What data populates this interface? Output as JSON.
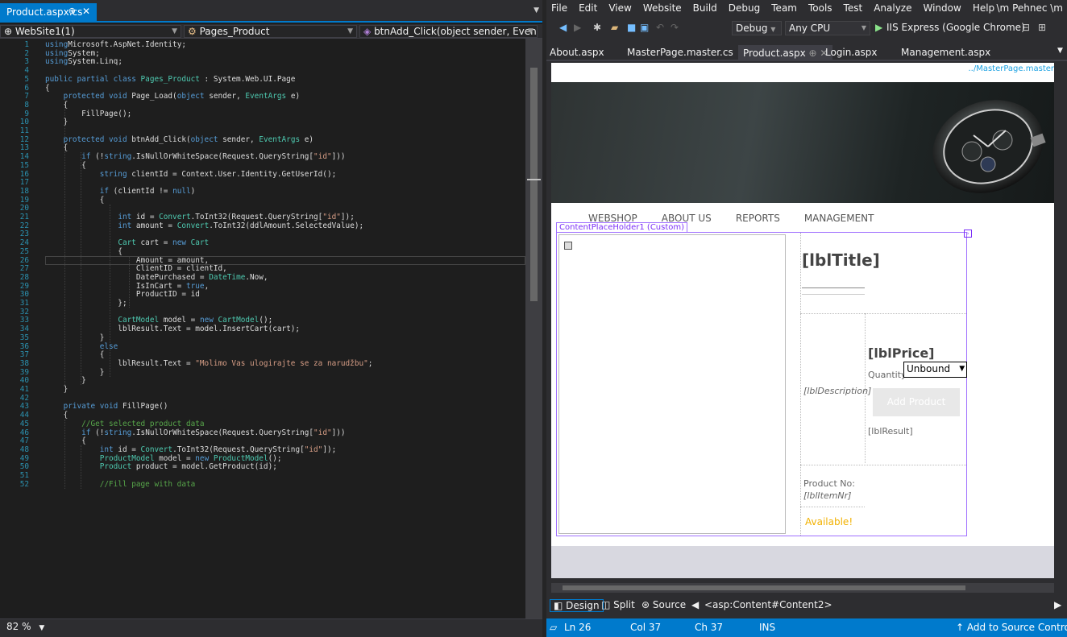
{
  "left_tab": {
    "label": "Product.aspx.cs",
    "pin": "⊕",
    "close": "✕"
  },
  "nav": {
    "project": "WebSite1(1)",
    "class": "Pages_Product",
    "member": "btnAdd_Click(object sender, EventArgs e"
  },
  "zoom": "82 %",
  "code_lines": [
    [
      [
        "kw",
        "using"
      ],
      [
        "",
        "Microsoft.AspNet.Identity;"
      ]
    ],
    [
      [
        "kw",
        "using"
      ],
      [
        "",
        "System;"
      ]
    ],
    [
      [
        "kw",
        "using"
      ],
      [
        "",
        "System.Linq;"
      ]
    ],
    [],
    [
      [
        "kw",
        "public partial class "
      ],
      [
        "ty",
        "Pages_Product"
      ],
      [
        "",
        " : System.Web.UI.Page"
      ]
    ],
    [
      [
        "",
        "{"
      ]
    ],
    [
      [
        "kw",
        "    protected void "
      ],
      [
        "",
        "Page_Load("
      ],
      [
        "kw",
        "object"
      ],
      [
        "",
        " sender, "
      ],
      [
        "ty",
        "EventArgs"
      ],
      [
        "",
        " e)"
      ]
    ],
    [
      [
        "",
        "    {"
      ]
    ],
    [
      [
        "",
        "        FillPage();"
      ]
    ],
    [
      [
        "",
        "    }"
      ]
    ],
    [],
    [
      [
        "kw",
        "    protected void "
      ],
      [
        "",
        "btnAdd_Click("
      ],
      [
        "kw",
        "object"
      ],
      [
        "",
        " sender, "
      ],
      [
        "ty",
        "EventArgs"
      ],
      [
        "",
        " e)"
      ]
    ],
    [
      [
        "",
        "    {"
      ]
    ],
    [
      [
        "",
        "        "
      ],
      [
        "kw",
        "if"
      ],
      [
        "",
        " (!"
      ],
      [
        "kw",
        "string"
      ],
      [
        "",
        ".IsNullOrWhiteSpace(Request.QueryString["
      ],
      [
        "st",
        "\"id\""
      ],
      [
        "",
        "]))"
      ]
    ],
    [
      [
        "",
        "        {"
      ]
    ],
    [
      [
        "",
        "            "
      ],
      [
        "kw",
        "string"
      ],
      [
        "",
        " clientId = Context.User.Identity.GetUserId();"
      ]
    ],
    [],
    [
      [
        "",
        "            "
      ],
      [
        "kw",
        "if"
      ],
      [
        "",
        " (clientId != "
      ],
      [
        "kw",
        "null"
      ],
      [
        "",
        ")"
      ]
    ],
    [
      [
        "",
        "            {"
      ]
    ],
    [],
    [
      [
        "",
        "                "
      ],
      [
        "kw",
        "int"
      ],
      [
        "",
        " id = "
      ],
      [
        "ty",
        "Convert"
      ],
      [
        "",
        ".ToInt32(Request.QueryString["
      ],
      [
        "st",
        "\"id\""
      ],
      [
        "",
        "]);"
      ]
    ],
    [
      [
        "",
        "                "
      ],
      [
        "kw",
        "int"
      ],
      [
        "",
        " amount = "
      ],
      [
        "ty",
        "Convert"
      ],
      [
        "",
        ".ToInt32(ddlAmount.SelectedValue);"
      ]
    ],
    [],
    [
      [
        "",
        "                "
      ],
      [
        "ty",
        "Cart"
      ],
      [
        "",
        " cart = "
      ],
      [
        "kw",
        "new "
      ],
      [
        "ty",
        "Cart"
      ]
    ],
    [
      [
        "",
        "                {"
      ]
    ],
    [
      [
        "",
        "                    Amount = amount,"
      ]
    ],
    [
      [
        "",
        "                    ClientID = clientId,"
      ]
    ],
    [
      [
        "",
        "                    DatePurchased = "
      ],
      [
        "ty",
        "DateTime"
      ],
      [
        "",
        ".Now,"
      ]
    ],
    [
      [
        "",
        "                    IsInCart = "
      ],
      [
        "kw",
        "true"
      ],
      [
        "",
        ","
      ]
    ],
    [
      [
        "",
        "                    ProductID = id"
      ]
    ],
    [
      [
        "",
        "                };"
      ]
    ],
    [],
    [
      [
        "",
        "                "
      ],
      [
        "ty",
        "CartModel"
      ],
      [
        "",
        " model = "
      ],
      [
        "kw",
        "new "
      ],
      [
        "ty",
        "CartModel"
      ],
      [
        "",
        "();"
      ]
    ],
    [
      [
        "",
        "                lblResult.Text = model.InsertCart(cart);"
      ]
    ],
    [
      [
        "",
        "            }"
      ]
    ],
    [
      [
        "",
        "            "
      ],
      [
        "kw",
        "else"
      ]
    ],
    [
      [
        "",
        "            {"
      ]
    ],
    [
      [
        "",
        "                lblResult.Text = "
      ],
      [
        "st",
        "\"Molimo Vas ulogirajte se za narudžbu\""
      ],
      [
        "",
        ";"
      ]
    ],
    [
      [
        "",
        "            }"
      ]
    ],
    [
      [
        "",
        "        }"
      ]
    ],
    [
      [
        "",
        "    }"
      ]
    ],
    [],
    [
      [
        "kw",
        "    private void "
      ],
      [
        "",
        "FillPage()"
      ]
    ],
    [
      [
        "",
        "    {"
      ]
    ],
    [
      [
        "cm",
        "        //Get selected product data"
      ]
    ],
    [
      [
        "",
        "        "
      ],
      [
        "kw",
        "if"
      ],
      [
        "",
        " (!"
      ],
      [
        "kw",
        "string"
      ],
      [
        "",
        ".IsNullOrWhiteSpace(Request.QueryString["
      ],
      [
        "st",
        "\"id\""
      ],
      [
        "",
        "]))"
      ]
    ],
    [
      [
        "",
        "        {"
      ]
    ],
    [
      [
        "",
        "            "
      ],
      [
        "kw",
        "int"
      ],
      [
        "",
        " id = "
      ],
      [
        "ty",
        "Convert"
      ],
      [
        "",
        ".ToInt32(Request.QueryString["
      ],
      [
        "st",
        "\"id\""
      ],
      [
        "",
        "]);"
      ]
    ],
    [
      [
        "",
        "            "
      ],
      [
        "ty",
        "ProductModel"
      ],
      [
        "",
        " model = "
      ],
      [
        "kw",
        "new "
      ],
      [
        "ty",
        "ProductModel"
      ],
      [
        "",
        "();"
      ]
    ],
    [
      [
        "",
        "            "
      ],
      [
        "ty",
        "Product"
      ],
      [
        "",
        " product = model.GetProduct(id);"
      ]
    ],
    [],
    [
      [
        "cm",
        "            //Fill page with data"
      ]
    ]
  ],
  "menu": [
    "File",
    "Edit",
    "View",
    "Website",
    "Build",
    "Debug",
    "Team",
    "Tools",
    "Test",
    "Analyze",
    "Window",
    "Help"
  ],
  "user": "\\m Pehnec \\m",
  "toolbar": {
    "config": "Debug",
    "platform": "Any CPU",
    "run": "IIS Express (Google Chrome)"
  },
  "doc_tabs": [
    "About.aspx",
    "MasterPage.master.cs",
    "Product.aspx",
    "Login.aspx",
    "Management.aspx"
  ],
  "master_path": "../MasterPage.master",
  "site_nav": [
    "WEBSHOP",
    "ABOUT US",
    "REPORTS",
    "MANAGEMENT"
  ],
  "cph_label": "ContentPlaceHolder1 (Custom)",
  "product": {
    "title": "[lblTitle]",
    "price": "[lblPrice]",
    "quantity_label": "Quantity:",
    "select": "Unbound",
    "add_button": "Add Product",
    "description": "[lblDescription]",
    "result": "[lblResult]",
    "product_no": "Product No:",
    "item_nr": "[lblItemNr]",
    "available": "Available!"
  },
  "view_buttons": {
    "design": "Design",
    "split": "Split",
    "source": "Source",
    "breadcrumb": "<asp:Content#Content2>"
  },
  "status": {
    "ln": "Ln 26",
    "col": "Col 37",
    "ch": "Ch 37",
    "ins": "INS",
    "source_control": "Add to Source Control"
  }
}
